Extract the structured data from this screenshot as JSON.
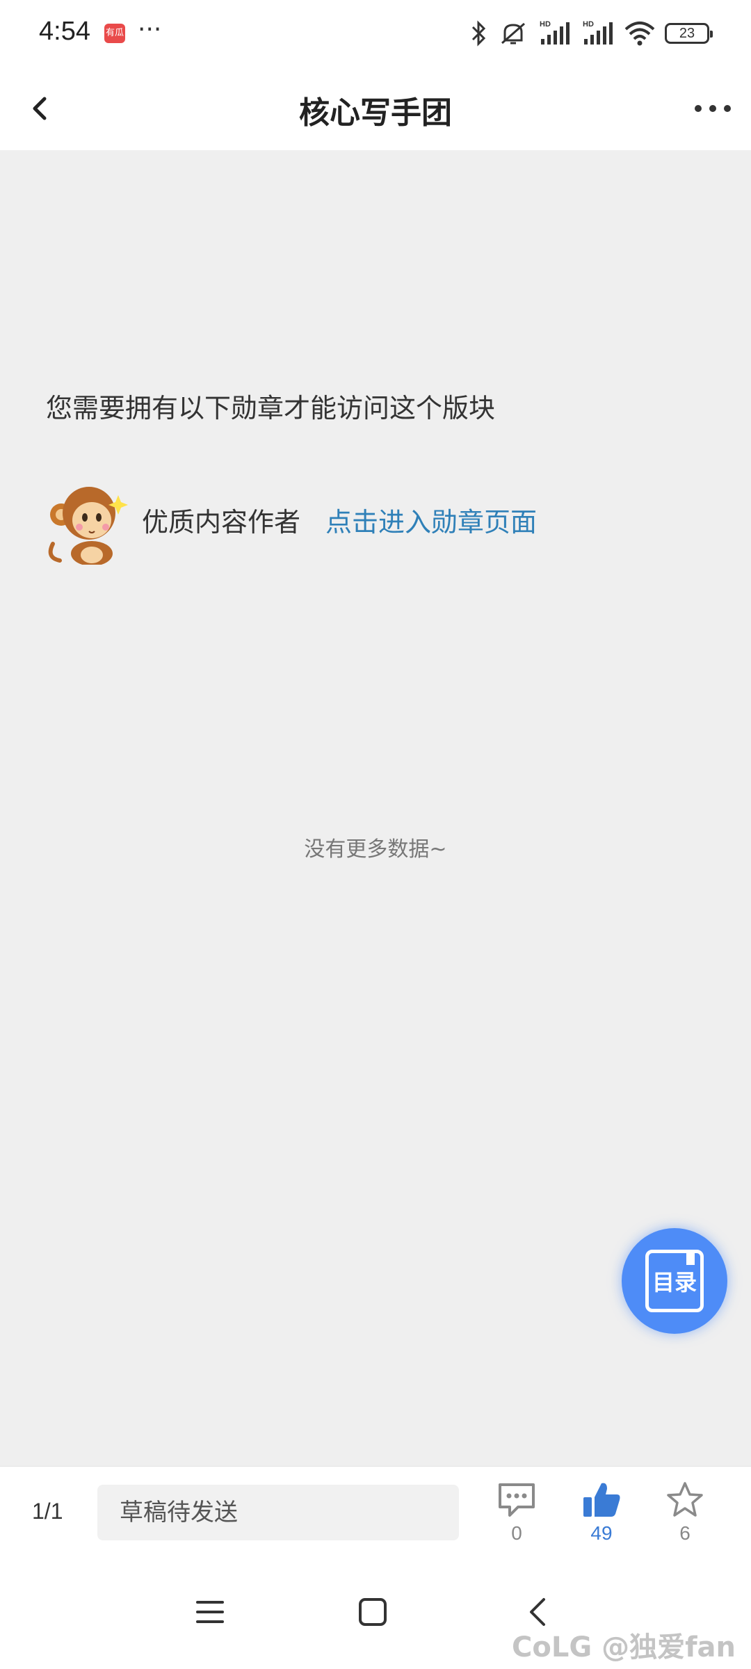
{
  "status_bar": {
    "time": "4:54",
    "app_icon_text": "有瓜",
    "more": "···",
    "battery": "23"
  },
  "header": {
    "title": "核心写手团"
  },
  "content": {
    "notice": "您需要拥有以下勋章才能访问这个版块",
    "badge_name": "优质内容作者",
    "badge_link": "点击进入勋章页面",
    "no_more": "没有更多数据~"
  },
  "fab": {
    "label": "目录"
  },
  "bottom_bar": {
    "page_indicator": "1/1",
    "draft_placeholder": "草稿待发送",
    "comment_count": "0",
    "like_count": "49",
    "favorite_count": "6",
    "like_color": "#3a7bd5"
  },
  "watermark": "CoLG @独爱fan"
}
